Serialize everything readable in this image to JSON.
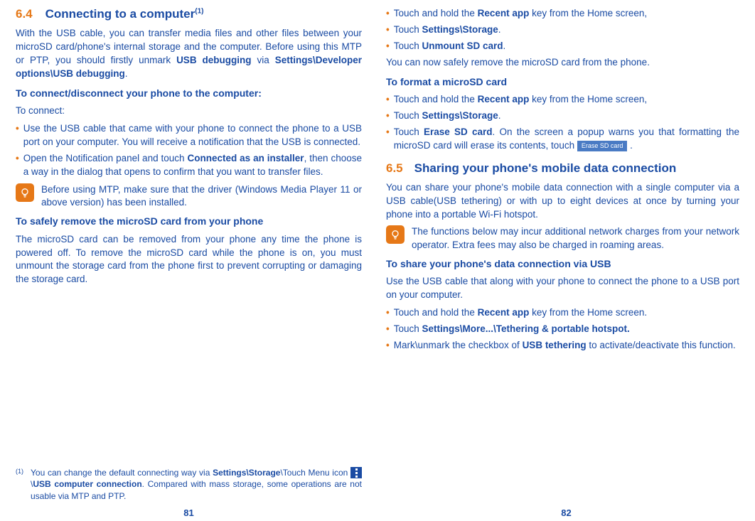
{
  "left": {
    "section_num": "6.4",
    "section_title": "Connecting to a computer",
    "footnote_mark": "(1)",
    "intro_p1": "With the USB cable, you can transfer media files and other files between your microSD card/phone's internal storage and the computer. Before using this MTP or PTP, you should firstly unmark ",
    "intro_b1": "USB debugging",
    "intro_p2": " via ",
    "intro_b2": "Settings\\Developer options\\USB debugging",
    "intro_p3": ".",
    "subhead1": "To connect/disconnect your phone to the computer:",
    "to_connect": "To connect:",
    "bullet1": "Use the USB cable that came with your phone to connect the phone to a USB port on your computer. You will receive a notification that the USB is connected.",
    "bullet2_p1": "Open the Notification panel and touch ",
    "bullet2_b": "Connected as an installer",
    "bullet2_p2": ", then choose a way in the dialog that opens to confirm that you want to transfer files.",
    "tip1": "Before using MTP, make sure that the driver (Windows Media Player 11 or above version) has been installed.",
    "subhead2": "To safely remove the microSD card from your phone",
    "para2": "The microSD card can be removed from your phone any time the phone is powered off. To remove the microSD card while the phone is on, you must unmount the storage card from the phone first to prevent corrupting or damaging the storage card.",
    "footnote_p1": "You can change the default connecting way via ",
    "footnote_b1": "Settings\\Storage",
    "footnote_p2": "\\Touch ",
    "footnote_menu_word": "Menu",
    "footnote_p3": " icon ",
    "footnote_p4": "\\",
    "footnote_b2": "USB computer connection",
    "footnote_p5": ". Compared with mass storage, some operations are not usable via MTP and PTP.",
    "page_num": "81"
  },
  "right": {
    "b1_p1": "Touch and hold the ",
    "b1_b": "Recent app",
    "b1_p2": " key from the Home screen,",
    "b2_p1": "Touch ",
    "b2_b": "Settings\\Storage",
    "b2_p2": ".",
    "b3_p1": "Touch ",
    "b3_b": "Unmount SD card",
    "b3_p2": ".",
    "para1": "You can now safely remove the microSD card from the phone.",
    "subhead1": "To format a microSD card",
    "b4_p1": "Touch and hold the ",
    "b4_b": "Recent app",
    "b4_p2": " key from the Home screen,",
    "b5_p1": "Touch ",
    "b5_b": "Settings\\Storage",
    "b5_p2": ".",
    "b6_p1": "Touch ",
    "b6_b": "Erase SD card",
    "b6_p2": ". On the screen a popup warns you that formatting the microSD card will erase its contents, touch ",
    "erase_btn": "Erase SD card",
    "b6_p3": " .",
    "section_num": "6.5",
    "section_title": "Sharing your phone's mobile data connection",
    "para2": "You can share your phone's mobile data connection with a single computer via a USB cable(USB tethering) or with up to eight devices at once by turning your phone into a portable Wi-Fi hotspot.",
    "tip1": "The functions below may incur additional network charges from your network operator. Extra fees may also be charged in roaming areas.",
    "subhead2": "To share your phone's data connection via USB",
    "para3": "Use the USB cable that along with your phone to connect the phone to a USB port on your computer.",
    "b7_p1": "Touch and hold the ",
    "b7_b": "Recent app",
    "b7_p2": " key from the Home screen.",
    "b8_p1": "Touch ",
    "b8_b": "Settings\\More...\\Tethering & portable hotspot.",
    "b9_p1": "Mark\\unmark the checkbox of ",
    "b9_b": "USB tethering",
    "b9_p2": " to activate/deactivate this function.",
    "page_num": "82"
  }
}
